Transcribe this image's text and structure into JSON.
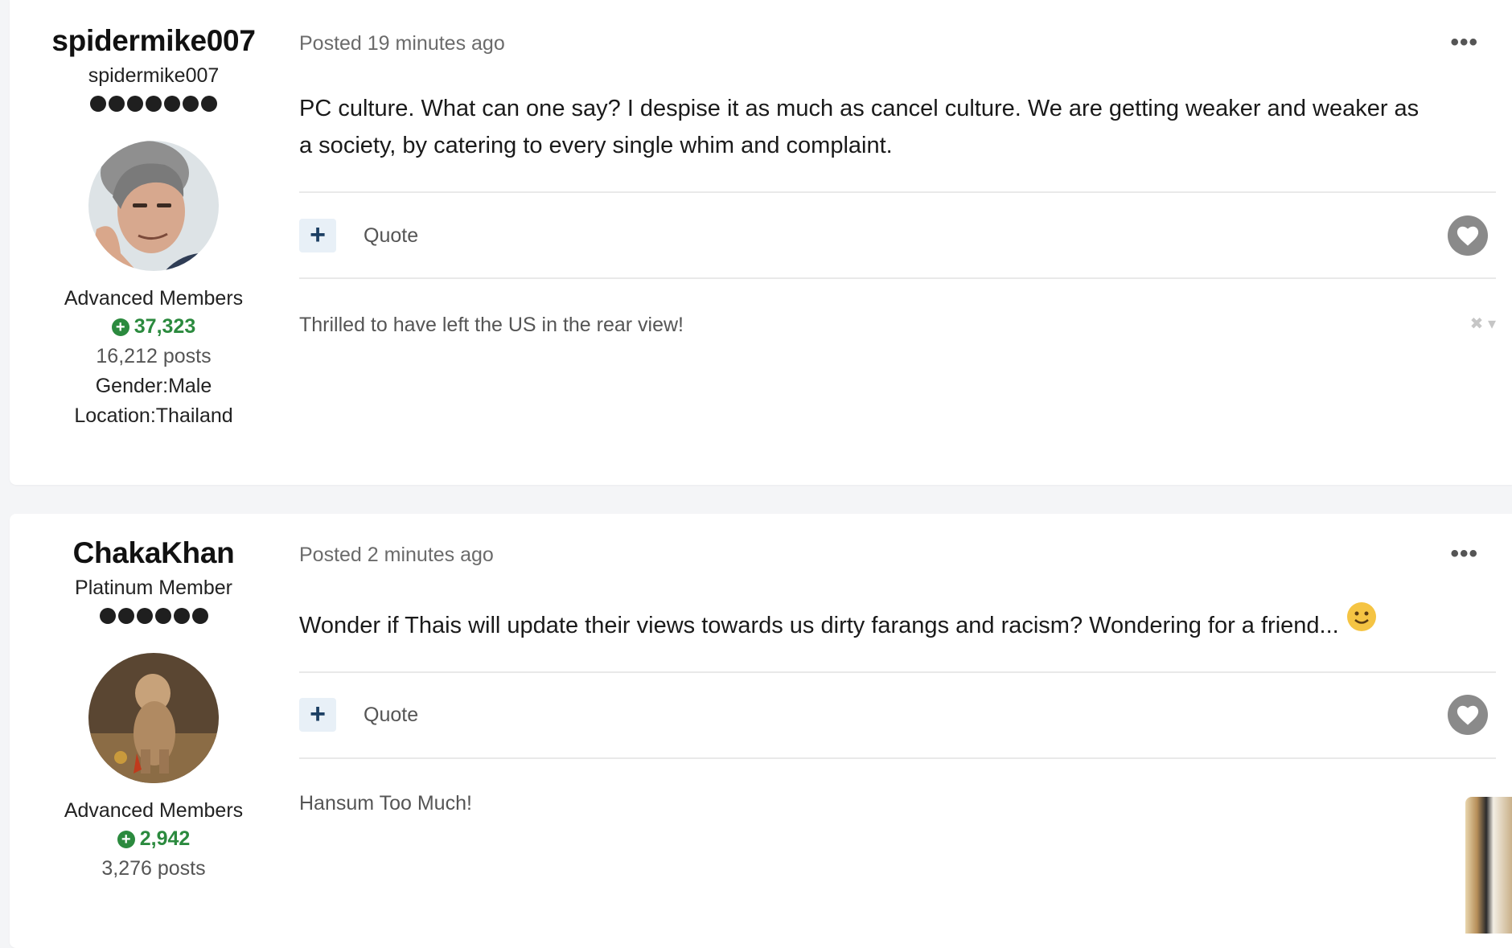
{
  "posts": [
    {
      "author": {
        "name": "spidermike007",
        "title": "spidermike007",
        "pip_count": 7,
        "group": "Advanced Members",
        "reputation": "37,323",
        "post_count": "16,212 posts",
        "gender": "Gender:Male",
        "location": "Location:Thailand"
      },
      "posted": "Posted 19 minutes ago",
      "body": "PC culture. What can one say? I despise it as much as cancel culture. We are getting weaker and weaker as a society, by catering to every single whim and complaint.",
      "quote_label": "Quote",
      "signature": "Thrilled to have left the US in the rear view!"
    },
    {
      "author": {
        "name": "ChakaKhan",
        "title": "Platinum Member",
        "pip_count": 6,
        "group": "Advanced Members",
        "reputation": "2,942",
        "post_count": "3,276 posts"
      },
      "posted": "Posted 2 minutes ago",
      "body": "Wonder if Thais will update their views towards us dirty farangs and racism?   Wondering for a friend...",
      "quote_label": "Quote",
      "signature": "Hansum Too Much!"
    }
  ],
  "icons": {
    "more": "ellipsis-icon",
    "plus": "plus-icon",
    "heart": "heart-icon",
    "reputation": "plus-circle-icon",
    "signature_controls": "close-icon",
    "emoji": "smiley-icon"
  },
  "colors": {
    "reputation": "#2b8a3e",
    "plus_button_bg": "#e8f0f7",
    "plus_button_fg": "#1c3f63",
    "heart": "#8a8a8a"
  }
}
